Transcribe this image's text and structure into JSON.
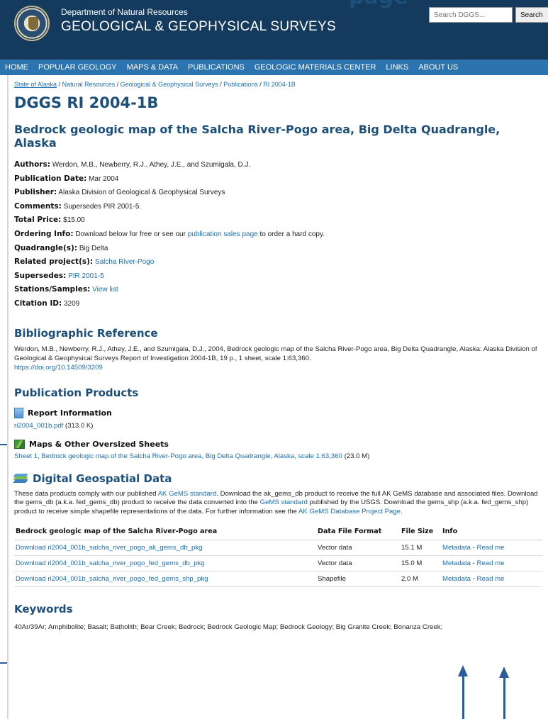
{
  "page": {
    "top_heading": "page"
  },
  "header": {
    "department": "Department of Natural Resources",
    "agency": "GEOLOGICAL & GEOPHYSICAL SURVEYS",
    "search_placeholder": "Search DGGS...",
    "search_button": "Search",
    "colors": {
      "header_bg": "#143a5e",
      "nav_bg": "#2c74b0",
      "heading": "#1c4f7a",
      "link": "#1a6fb8"
    }
  },
  "nav": [
    "HOME",
    "POPULAR GEOLOGY",
    "MAPS & DATA",
    "PUBLICATIONS",
    "GEOLOGIC MATERIALS CENTER",
    "LINKS",
    "ABOUT US"
  ],
  "breadcrumb": [
    "State of Alaska",
    "Natural Resources",
    "Geological & Geophysical Surveys",
    "Publications",
    "RI 2004-1B"
  ],
  "page_title": "DGGS RI 2004-1B",
  "publication_title": "Bedrock geologic map of the Salcha River-Pogo area, Big Delta Quadrangle, Alaska",
  "meta": {
    "authors_label": "Authors:",
    "authors": "Werdon, M.B., Newberry, R.J., Athey, J.E., and Szumigala, D.J.",
    "date_label": "Publication Date:",
    "date": "Mar 2004",
    "publisher_label": "Publisher:",
    "publisher": "Alaska Division of Geological & Geophysical Surveys",
    "comments_label": "Comments:",
    "comments": "Supersedes PIR 2001-5.",
    "price_label": "Total Price:",
    "price": "$15.00",
    "ordering_label": "Ordering Info:",
    "ordering_pre": "Download below for free or see our",
    "ordering_link": "publication sales page",
    "ordering_post": "to order a hard copy.",
    "quadrangle_label": "Quadrangle(s):",
    "quadrangle": "Big Delta",
    "related_label": "Related project(s):",
    "related": "Salcha River-Pogo",
    "supersedes_label": "Supersedes:",
    "supersedes": "PIR 2001-5",
    "stations_label": "Stations/Samples:",
    "stations": "View list",
    "citation_label": "Citation ID:",
    "citation": "3209"
  },
  "bibliographic": {
    "heading": "Bibliographic Reference",
    "text": "Werdon, M.B., Newberry, R.J., Athey, J.E., and Szumigala, D.J., 2004, Bedrock geologic map of the Salcha River-Pogo area, Big Delta Quadrangle, Alaska: Alaska Division of Geological & Geophysical Surveys Report of Investigation 2004-1B, 19 p., 1 sheet, scale 1:63,360.",
    "doi": "https://doi.org/10.14509/3209"
  },
  "products": {
    "heading": "Publication Products",
    "report_heading": "Report Information",
    "report_link": "ri2004_001b.pdf",
    "report_size": "(313.0 K)",
    "maps_heading": "Maps & Other Oversized Sheets",
    "maps_link": "Sheet 1, Bedrock geologic map of the Salcha River-Pogo area, Big Delta Quadrangle, Alaska, scale 1:63,360",
    "maps_size": "(23.0 M)"
  },
  "geospatial": {
    "heading": "Digital Geospatial Data",
    "p1": "These data products comply with our published",
    "link1": "AK GeMS standard",
    "p2": ". Download the ak_gems_db product to receive the full AK GeMS database and associated files. Download the gems_db (a.k.a. fed_gems_db) product to receive the data converted into the",
    "link2": "GeMS standard",
    "p3": "published by the USGS. Download the gems_shp (a.k.a. fed_gems_shp) product to receive simple shapefile representations of the data. For further information see the",
    "link3": "AK GeMS Database Project Page",
    "p4": ".",
    "columns": [
      "Bedrock geologic map of the Salcha River-Pogo area",
      "Data File Format",
      "File Size",
      "Info"
    ],
    "rows": [
      {
        "link": "Download ri2004_001b_salcha_river_pogo_ak_gems_db_pkg",
        "format": "Vector data",
        "size": "15.1 M",
        "metadata": "Metadata",
        "sep": " - ",
        "readme": "Read me"
      },
      {
        "link": "Download ri2004_001b_salcha_river_pogo_fed_gems_db_pkg",
        "format": "Vector data",
        "size": "15.0 M",
        "metadata": "Metadata",
        "sep": " - ",
        "readme": "Read me"
      },
      {
        "link": "Download ri2004_001b_salcha_river_pogo_fed_gems_shp_pkg",
        "format": "Shapefile",
        "size": "2.0 M",
        "metadata": "Metadata",
        "sep": " - ",
        "readme": "Read me"
      }
    ]
  },
  "keywords": {
    "heading": "Keywords",
    "text": "40Ar/39Ar; Amphibolite; Basalt; Batholith; Bear Creek; Bedrock; Bedrock Geologic Map; Bedrock Geology; Big Granite Creek; Bonanza Creek;"
  }
}
